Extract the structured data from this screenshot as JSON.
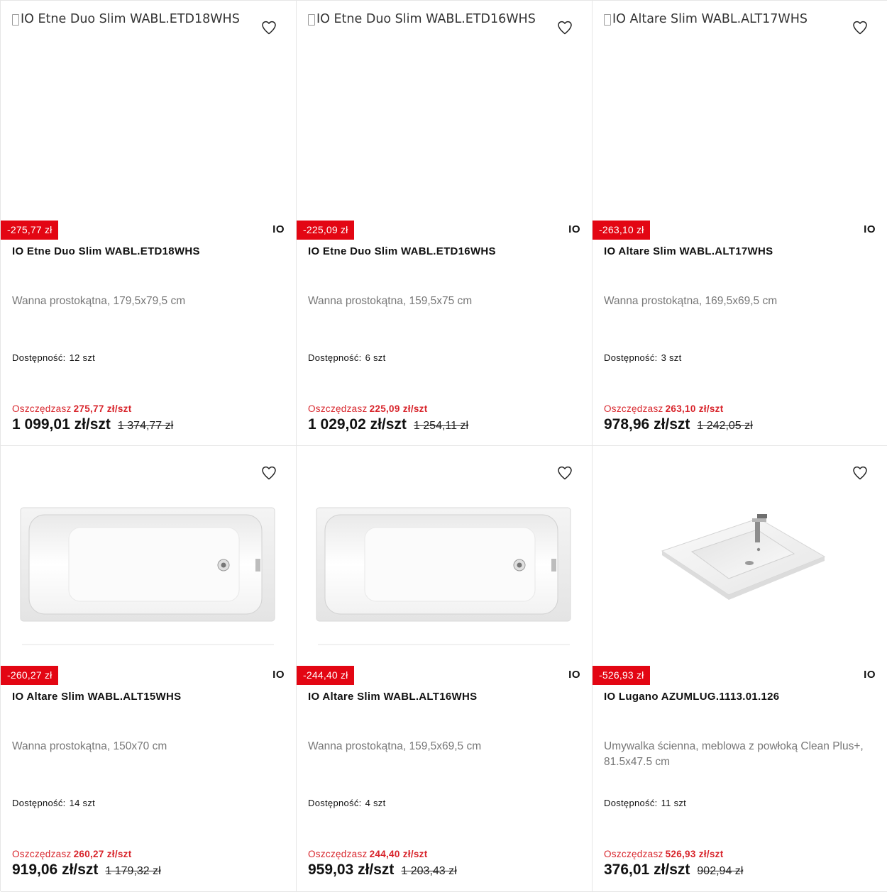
{
  "labels": {
    "availability": "Dostępność:",
    "savings": "Oszczędzasz"
  },
  "colors": {
    "discount_bg": "#e30613",
    "savings_text": "#d8232a",
    "border": "#e6e6e6"
  },
  "icons": {
    "favorite": "heart-outline-icon"
  },
  "products": [
    {
      "image_alt": "IO Etne Duo Slim WABL.ETD18WHS",
      "image_loaded": false,
      "discount": "-275,77 zł",
      "brand": "IO",
      "name": "IO Etne Duo Slim WABL.ETD18WHS",
      "description": "Wanna prostokątna, 179,5x79,5 cm",
      "availability": "12 szt",
      "savings": "275,77 zł/szt",
      "price": "1 099,01 zł/szt",
      "old_price": "1 374,77 zł"
    },
    {
      "image_alt": "IO Etne Duo Slim WABL.ETD16WHS",
      "image_loaded": false,
      "discount": "-225,09 zł",
      "brand": "IO",
      "name": "IO Etne Duo Slim WABL.ETD16WHS",
      "description": "Wanna prostokątna, 159,5x75 cm",
      "availability": "6 szt",
      "savings": "225,09 zł/szt",
      "price": "1 029,02 zł/szt",
      "old_price": "1 254,11 zł"
    },
    {
      "image_alt": "IO Altare Slim WABL.ALT17WHS",
      "image_loaded": false,
      "discount": "-263,10 zł",
      "brand": "IO",
      "name": "IO Altare Slim WABL.ALT17WHS",
      "description": "Wanna prostokątna, 169,5x69,5 cm",
      "availability": "3 szt",
      "savings": "263,10 zł/szt",
      "price": "978,96 zł/szt",
      "old_price": "1 242,05 zł"
    },
    {
      "image_loaded": true,
      "image_kind": "bathtub",
      "discount": "-260,27 zł",
      "brand": "IO",
      "name": "IO Altare Slim WABL.ALT15WHS",
      "description": "Wanna prostokątna, 150x70 cm",
      "availability": "14 szt",
      "savings": "260,27 zł/szt",
      "price": "919,06 zł/szt",
      "old_price": "1 179,32 zł"
    },
    {
      "image_loaded": true,
      "image_kind": "bathtub",
      "discount": "-244,40 zł",
      "brand": "IO",
      "name": "IO Altare Slim WABL.ALT16WHS",
      "description": "Wanna prostokątna, 159,5x69,5 cm",
      "availability": "4 szt",
      "savings": "244,40 zł/szt",
      "price": "959,03 zł/szt",
      "old_price": "1 203,43 zł"
    },
    {
      "image_loaded": true,
      "image_kind": "washbasin",
      "discount": "-526,93 zł",
      "brand": "IO",
      "name": "IO Lugano AZUMLUG.1113.01.126",
      "description": "Umywalka ścienna, meblowa z powłoką Clean Plus+, 81.5x47.5 cm",
      "availability": "11 szt",
      "savings": "526,93 zł/szt",
      "price": "376,01 zł/szt",
      "old_price": "902,94 zł"
    }
  ]
}
